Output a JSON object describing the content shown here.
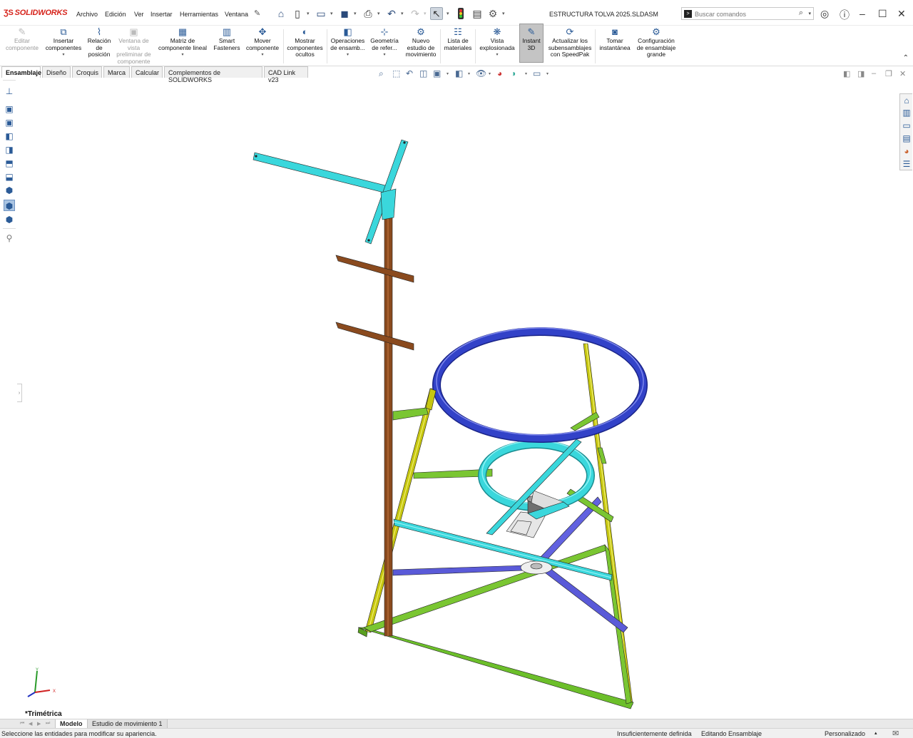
{
  "app": {
    "logo_text": "SOLIDWORKS",
    "document_title": "ESTRUCTURA TOLVA 2025.SLDASM"
  },
  "menu": [
    "Archivo",
    "Edición",
    "Ver",
    "Insertar",
    "Herramientas",
    "Ventana"
  ],
  "search": {
    "placeholder": "Buscar comandos"
  },
  "ribbon": {
    "editar": "Editar componente",
    "insertar": "Insertar componentes",
    "relacion": "Relación de posición",
    "ventana": "Ventana de vista preliminar de componente",
    "matriz": "Matriz de componente lineal",
    "smart": "Smart Fasteners",
    "mover": "Mover componente",
    "mostrar": "Mostrar componentes ocultos",
    "operaciones": "Operaciones de ensamb...",
    "geometria": "Geometría de refer...",
    "nuevo": "Nuevo estudio de movimiento",
    "lista": "Lista de materiales",
    "explosionada": "Vista explosionada",
    "instant": "Instant 3D",
    "actualizar": "Actualizar los subensamblajes con SpeedPak",
    "tomar": "Tomar instantánea",
    "configuracion": "Configuración de ensamblaje grande"
  },
  "tabs": [
    "Ensamblaje",
    "Diseño",
    "Croquis",
    "Marca",
    "Calcular",
    "Complementos de SOLIDWORKS",
    "CAD Link v23"
  ],
  "viewport": {
    "view_name": "*Trimétrica",
    "axis_x": "X",
    "axis_y": "Y"
  },
  "bottom_tabs": [
    "Modelo",
    "Estudio de movimiento 1"
  ],
  "status": {
    "message": "Seleccione las entidades para modificar su apariencia.",
    "definition": "Insuficientemente definida",
    "mode": "Editando Ensamblaje",
    "units": "Personalizado"
  },
  "colors": {
    "frame_yellow": "#c6c610",
    "frame_green": "#7ac632",
    "ring_blue": "#3242c8",
    "ring_cyan": "#3ad7dc",
    "post_brown": "#8a4a1e",
    "brace_indigo": "#5a5ad8",
    "logo_red": "#d6221a"
  },
  "icons": [
    "home-icon",
    "new-document-icon",
    "open-folder-icon",
    "save-icon",
    "print-icon",
    "undo-icon",
    "redo-icon",
    "select-arrow-icon",
    "traffic-light-icon",
    "file-properties-icon",
    "options-gear-icon",
    "user-account-icon",
    "help-icon"
  ]
}
